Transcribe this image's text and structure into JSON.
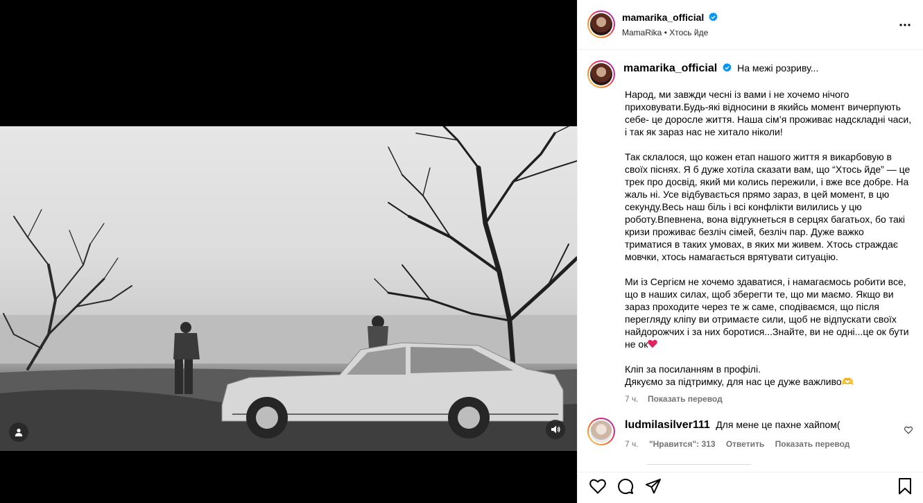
{
  "post": {
    "username": "mamarika_official",
    "subtitle_artist": "MamaRika",
    "subtitle_separator": "•",
    "subtitle_audio": "Хтось йде",
    "more_label": "•••"
  },
  "caption": {
    "username": "mamarika_official",
    "first_line": "На межі розриву...",
    "paragraphs": [
      "Народ, ми завжди чесні із вами і не хочемо нічого приховувати.Будь-які відносини в якийсь момент вичерпують себе- це доросле життя. Наша сім’я проживає надскладні часи, і так як зараз нас не хитало ніколи!",
      "Так склалося, що кожен етап нашого життя я викарбовую в своїх піснях. Я б дуже хотіла сказати вам, що “Хтось йде” — це трек про досвід, який ми колись пережили, і вже все добре. На жаль ні. Усе відбувається прямо зараз, в цей момент, в цю секунду.Весь наш біль і всі конфлікти вилились у цю роботу.Впевнена, вона відгукнеться в серцях багатьох, бо такі кризи проживає безліч сімей, безліч пар. Дуже важко триматися в таких умовах, в яких ми живем. Хтось страждає мовчки, хтось намагається врятувати ситуацію.",
      "Ми із Сергієм не хочемо здаватися, і намагаємось робити все, що в наших силах, щоб зберегти те, що ми маємо. Якщо ви зараз проходите через те ж саме, сподіваємся, що після перегляду кліпу ви отримаєте сили, щоб не відпускати своїх найдорожчих і за них боротися...Знайте, ви не одні...це ок бути не ок"
    ],
    "closing_line_1": "Кліп за посиланням в профілі.",
    "closing_line_2": "Дякуємо за підтримку, для нас це дуже важливо🫶",
    "time": "7 ч.",
    "translate_label": "Показать перевод"
  },
  "comments": [
    {
      "username": "ludmilasilver111",
      "text": "Для мене це пахне хайпом(",
      "time": "7 ч.",
      "likes_label": "\"Нравится\": 313",
      "reply_label": "Ответить",
      "translate_label": "Показать перевод"
    }
  ],
  "icons": {
    "verified": "verified-badge-icon",
    "like": "heart-icon",
    "comment": "comment-icon",
    "share": "share-icon",
    "save": "bookmark-icon",
    "mute": "speaker-icon",
    "tags": "user-tag-icon"
  },
  "colors": {
    "verified_blue": "#0095f6",
    "heart_red": "#e0245e",
    "secondary_text": "#737373"
  }
}
